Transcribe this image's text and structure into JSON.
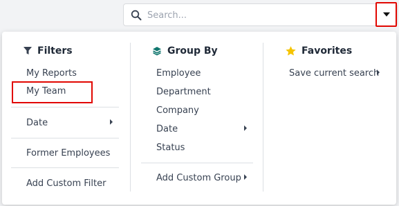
{
  "search": {
    "placeholder": "Search..."
  },
  "filters": {
    "title": "Filters",
    "items": [
      "My Reports",
      "My Team",
      "Date",
      "Former Employees",
      "Add Custom Filter"
    ]
  },
  "group_by": {
    "title": "Group By",
    "items": [
      "Employee",
      "Department",
      "Company",
      "Date",
      "Status",
      "Add Custom Group"
    ]
  },
  "favorites": {
    "title": "Favorites",
    "items": [
      "Save current search"
    ]
  },
  "colors": {
    "accent_red": "#e10600",
    "favorite_star": "#f5c400",
    "group_icon": "#0f766e"
  }
}
